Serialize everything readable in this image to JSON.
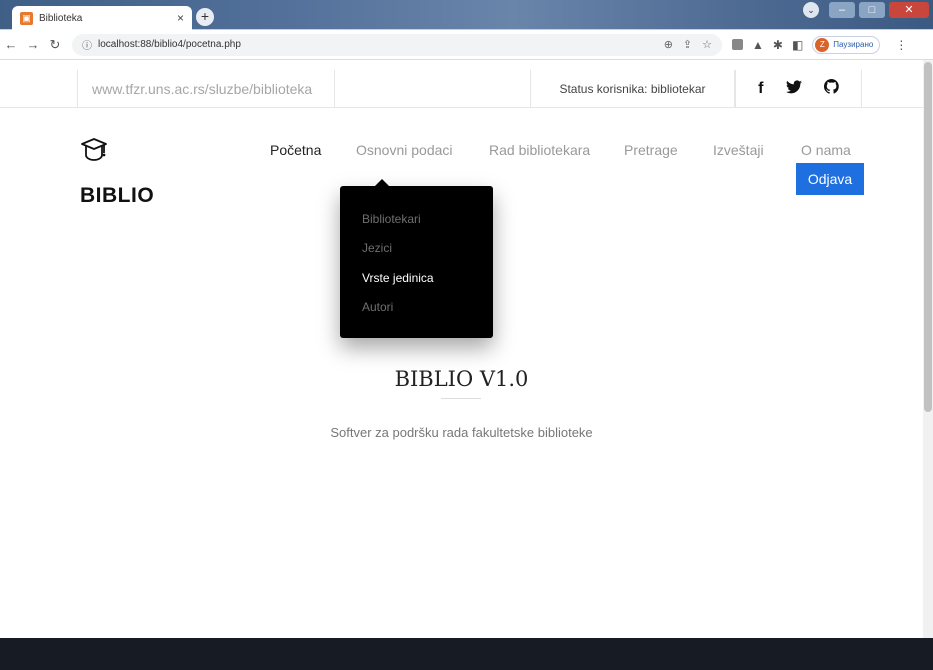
{
  "browser": {
    "tab_title": "Biblioteka",
    "tab_close": "×",
    "new_tab": "+",
    "url": "localhost:88/biblio4/pocetna.php",
    "profile_label": "Паузирано",
    "profile_initial": "Z"
  },
  "topbar": {
    "site_url": "www.tfzr.uns.ac.rs/sluzbe/biblioteka",
    "status": "Status korisnika: bibliotekar",
    "social": [
      "f",
      "twitter-icon",
      "github-icon"
    ]
  },
  "brand": "BIBLIO",
  "nav": {
    "items": [
      "Početna",
      "Osnovni podaci",
      "Rad bibliotekara",
      "Pretrage",
      "Izveštaji",
      "O nama"
    ],
    "active_index": 0,
    "logout": "Odjava"
  },
  "dropdown": {
    "items": [
      "Bibliotekari",
      "Jezici",
      "Vrste jedinica",
      "Autori"
    ],
    "hover_index": 2
  },
  "main": {
    "title": "BIBLIO V1.0",
    "subtitle": "Softver za podršku rada fakultetske biblioteke"
  },
  "colors": {
    "accent": "#1e6fe0",
    "dropdown_bg": "#000000",
    "footer_bg": "#161b24"
  }
}
